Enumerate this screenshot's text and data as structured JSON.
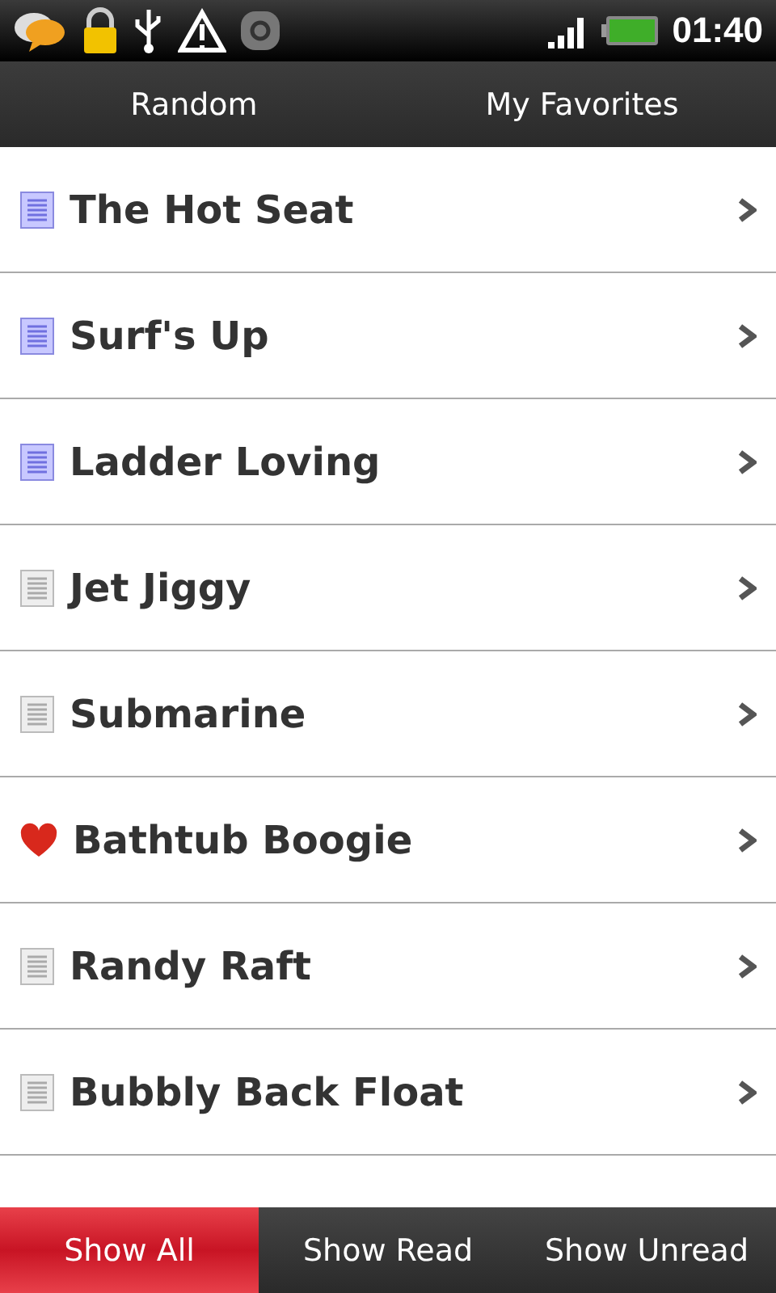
{
  "status_bar": {
    "time": "01:40"
  },
  "top_bar": {
    "buttons": [
      "Random",
      "My Favorites"
    ]
  },
  "items": [
    {
      "title": "The Hot Seat",
      "kind": "unread"
    },
    {
      "title": "Surf's Up",
      "kind": "unread"
    },
    {
      "title": "Ladder Loving",
      "kind": "unread"
    },
    {
      "title": "Jet Jiggy",
      "kind": "read"
    },
    {
      "title": "Submarine",
      "kind": "read"
    },
    {
      "title": "Bathtub Boogie",
      "kind": "favorite"
    },
    {
      "title": "Randy Raft",
      "kind": "read"
    },
    {
      "title": "Bubbly Back Float",
      "kind": "read"
    }
  ],
  "filter_tabs": [
    {
      "label": "Show All",
      "selected": true
    },
    {
      "label": "Show Read",
      "selected": false
    },
    {
      "label": "Show Unread",
      "selected": false
    }
  ]
}
